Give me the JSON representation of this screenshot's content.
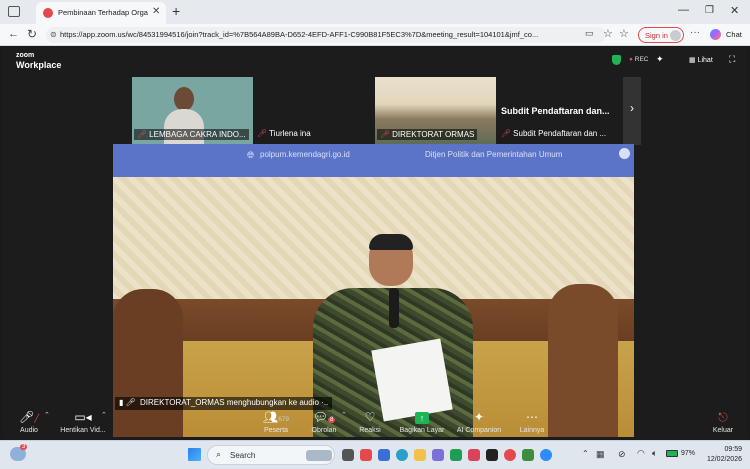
{
  "browser": {
    "tab_title": "Pembinaan Terhadap Organis",
    "url": "https://app.zoom.us/wc/84531994516/join?track_id=%7B564A89BA-D652-4EFD-AFF1-C990B81F5EC3%7D&meeting_result=104101&jmf_co...",
    "signin_label": "Sign in",
    "chat_label": "Chat"
  },
  "zoom": {
    "logo_line1": "zoom",
    "logo_line2": "Workplace",
    "rec_label": "REC",
    "view_label": "Lihat",
    "participants": [
      {
        "name": "LEMBAGA CAKRA INDO..."
      },
      {
        "name": "Tiurlena ina"
      },
      {
        "name": "DIREKTORAT ORMAS"
      },
      {
        "name": "Subdit Pendaftaran dan ..."
      }
    ],
    "large_tile_name": "Subdit Pendaftaran dan...",
    "banner_site": "polpum.kemendagri.go.id",
    "banner_dept": "Ditjen Politik dan Pemerintahan Umum",
    "speaker_status": "DIREKTORAT_ORMAS menghubungkan ke audio ·..",
    "controls": {
      "audio": "Audio",
      "video": "Hentikan Vid...",
      "participants": "Peserta",
      "participant_count": "679",
      "chat": "Obrolan",
      "chat_badge": "8",
      "reactions": "Reaksi",
      "share": "Bagikan Layar",
      "ai": "AI Companion",
      "more": "Lainnya",
      "leave": "Keluar"
    }
  },
  "taskbar": {
    "search_placeholder": "Search",
    "weather_badge": "3",
    "battery": "97%",
    "time": "09:59",
    "date": "12/02/2026"
  },
  "colors": {
    "zoom_bg": "#1c1c1c",
    "accent_green": "#20b356",
    "rec_red": "#e5484d",
    "browser_bg": "#f7f8fa"
  }
}
